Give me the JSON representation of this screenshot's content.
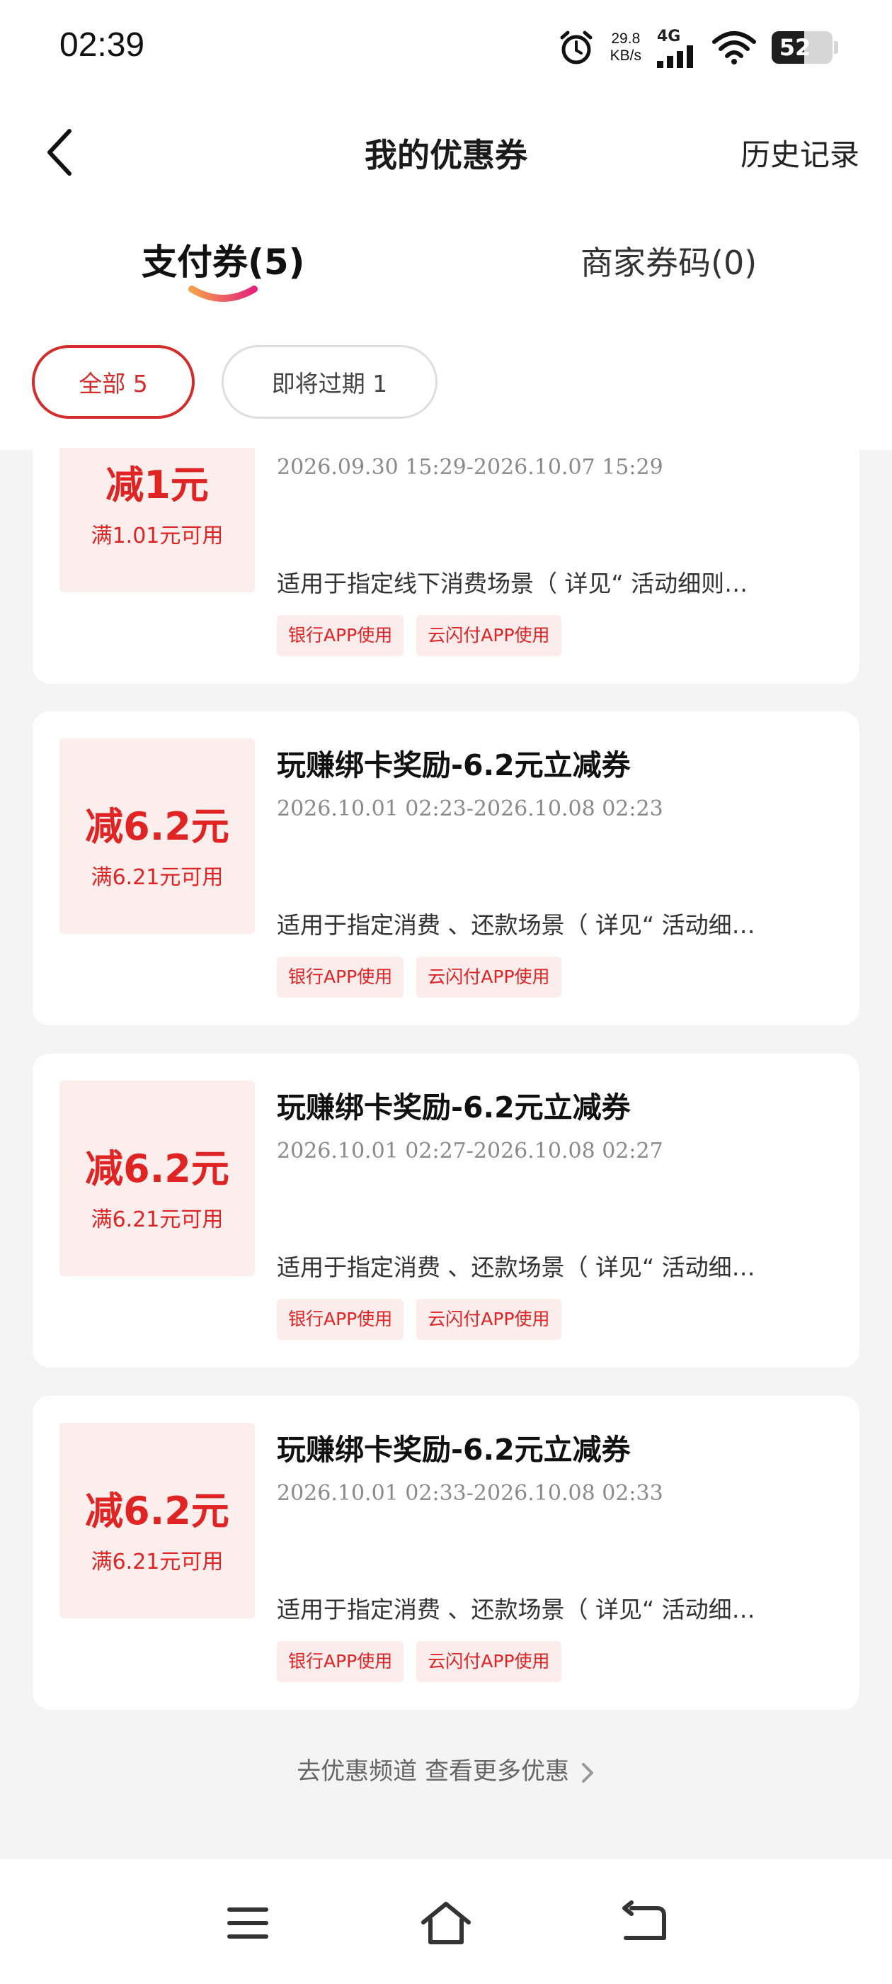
{
  "status": {
    "time": "02:39",
    "speed_value": "29.8",
    "speed_unit": "KB/s",
    "network": "4G",
    "battery": "52"
  },
  "header": {
    "title": "我的优惠券",
    "history": "历史记录"
  },
  "tabs": [
    {
      "label": "支付券(5)",
      "active": true
    },
    {
      "label": "商家券码(0)",
      "active": false
    }
  ],
  "filters": [
    {
      "label": "全部 5",
      "active": true
    },
    {
      "label": "即将过期 1",
      "active": false
    }
  ],
  "coupons": [
    {
      "amount": "减1元",
      "threshold": "满1.01元可用",
      "title": "",
      "date": "2026.09.30 15:29-2026.10.07 15:29",
      "desc": "适用于指定线下消费场景（ 详见“ 活动细则…",
      "tags": [
        "银行APP使用",
        "云闪付APP使用"
      ]
    },
    {
      "amount": "减6.2元",
      "threshold": "满6.21元可用",
      "title": "玩赚绑卡奖励-6.2元立减券",
      "date": "2026.10.01 02:23-2026.10.08 02:23",
      "desc": "适用于指定消费 、还款场景（ 详见“ 活动细…",
      "tags": [
        "银行APP使用",
        "云闪付APP使用"
      ]
    },
    {
      "amount": "减6.2元",
      "threshold": "满6.21元可用",
      "title": "玩赚绑卡奖励-6.2元立减券",
      "date": "2026.10.01 02:27-2026.10.08 02:27",
      "desc": "适用于指定消费 、还款场景（ 详见“ 活动细…",
      "tags": [
        "银行APP使用",
        "云闪付APP使用"
      ]
    },
    {
      "amount": "减6.2元",
      "threshold": "满6.21元可用",
      "title": "玩赚绑卡奖励-6.2元立减券",
      "date": "2026.10.01 02:33-2026.10.08 02:33",
      "desc": "适用于指定消费 、还款场景（ 详见“ 活动细…",
      "tags": [
        "银行APP使用",
        "云闪付APP使用"
      ]
    }
  ],
  "more_link": "去优惠频道 查看更多优惠",
  "colors": {
    "accent": "#e02424",
    "coupon_bg": "#fdeeee",
    "page_bg": "#f4f4f4"
  },
  "icons": {
    "back": "chevron-left-icon",
    "alarm": "alarm-icon",
    "signal": "signal-icon",
    "wifi": "wifi-icon",
    "nav_menu": "menu-icon",
    "nav_home": "home-icon",
    "nav_back": "back-icon"
  }
}
